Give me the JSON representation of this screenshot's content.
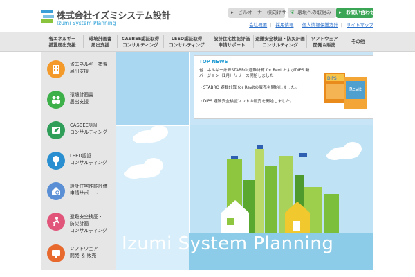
{
  "header": {
    "logo_jp": "株式会社イズミシステム設計",
    "logo_en": "Izumi System Planning",
    "btn_owner": "ビルオーナー様向けサイト",
    "btn_env": "環境への取組み",
    "btn_contact": "お問い合わせ",
    "sub_links": [
      "会社概要",
      "採用情報",
      "個人情報保護方針",
      "サイトマップ"
    ]
  },
  "nav": {
    "items": [
      "省エネルギー\n措置届出支援",
      "環境計画書\n届出支援",
      "CASBEE認証取得\nコンサルティング",
      "LEED認証取得\nコンサルティング",
      "設計住宅性能評価\n申請サポート",
      "避難安全検証・防災計画\nコンサルティング",
      "ソフトウェア\n開発＆販売",
      "その他"
    ]
  },
  "services": [
    {
      "label": "省エネルギー措置\n届出支援",
      "icon": "building-icon",
      "color": "#f39a2a"
    },
    {
      "label": "環境計画書\n届出支援",
      "icon": "people-icon",
      "color": "#3db04a"
    },
    {
      "label": "CASBEE認証\nコンサルティング",
      "icon": "leaf-icon",
      "color": "#2e9e58"
    },
    {
      "label": "LEED認証\nコンサルティング",
      "icon": "tree-icon",
      "color": "#2a8fd0"
    },
    {
      "label": "設計住宅性能評価\n申請サポート",
      "icon": "house-search-icon",
      "color": "#5a8fd6"
    },
    {
      "label": "避難安全検証・\n防災計画\nコンサルティング",
      "icon": "evacuation-icon",
      "color": "#e2557a"
    },
    {
      "label": "ソフトウェア\n開発 ＆ 販売",
      "icon": "monitor-icon",
      "color": "#e8692e"
    }
  ],
  "news": {
    "heading": "TOP NEWS",
    "items": [
      "省エネルギー計算STABRO 避難計算 for RevitおよびDiPS 新バージョン（1月）リリース開始しました",
      "・STABRO 避難計算 for Revitの販売を開始しました。",
      "・DiPS 避難安全検証ソフトの販売を開始しました。"
    ],
    "book1_label": "DiPS",
    "book2_label": "Revit"
  },
  "hero": {
    "title": "Izumi System Planning"
  }
}
